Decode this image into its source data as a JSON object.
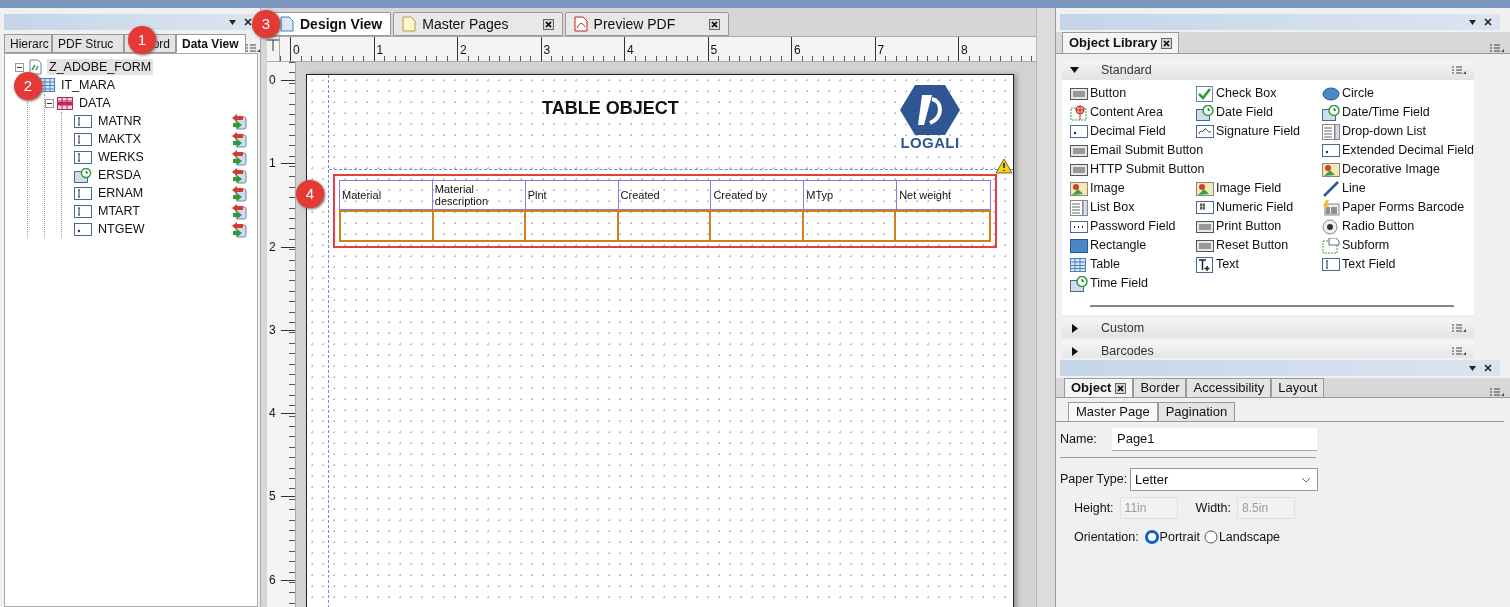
{
  "callouts": [
    {
      "number": "1"
    },
    {
      "number": "2"
    },
    {
      "number": "3"
    },
    {
      "number": "4"
    }
  ],
  "left_panel": {
    "tabs": [
      {
        "label": "Hierarc",
        "selected": false
      },
      {
        "label": "PDF Struc",
        "selected": false
      },
      {
        "label": "ord",
        "selected": false
      },
      {
        "label": "Data View",
        "selected": true
      }
    ],
    "tree": [
      {
        "label": "Z_ADOBE_FORM",
        "kind": "form",
        "expanded": true,
        "selected": true,
        "children": [
          {
            "label": "IT_MARA",
            "kind": "table",
            "selected": false,
            "children": [
              {
                "label": "DATA",
                "kind": "data",
                "expanded": true,
                "selected": false,
                "children": [
                  {
                    "label": "MATNR",
                    "kind": "text",
                    "selected": false,
                    "bound": true
                  },
                  {
                    "label": "MAKTX",
                    "kind": "text",
                    "selected": false,
                    "bound": true
                  },
                  {
                    "label": "WERKS",
                    "kind": "text",
                    "selected": false,
                    "bound": true
                  },
                  {
                    "label": "ERSDA",
                    "kind": "date",
                    "selected": false,
                    "bound": true
                  },
                  {
                    "label": "ERNAM",
                    "kind": "text",
                    "selected": false,
                    "bound": true
                  },
                  {
                    "label": "MTART",
                    "kind": "text",
                    "selected": false,
                    "bound": true
                  },
                  {
                    "label": "NTGEW",
                    "kind": "decimal",
                    "selected": false,
                    "bound": true
                  }
                ]
              }
            ]
          }
        ]
      }
    ]
  },
  "document_tabs": [
    {
      "label": "Design View",
      "kind": "design",
      "selected": true,
      "closable": false
    },
    {
      "label": "Master Pages",
      "kind": "page",
      "selected": false,
      "closable": true
    },
    {
      "label": "Preview PDF",
      "kind": "pdf",
      "selected": false,
      "closable": true
    }
  ],
  "rulers": {
    "horizontal": [
      "0",
      "1",
      "2",
      "3",
      "4",
      "5",
      "6",
      "7",
      "8"
    ],
    "vertical": [
      "0",
      "1",
      "2",
      "3",
      "4",
      "5",
      "6"
    ]
  },
  "page": {
    "title": "TABLE OBJECT",
    "logo_text": "LOGALI",
    "warning": true,
    "table": {
      "columns": [
        "Material",
        "Material description",
        "Plnt",
        "Created",
        "Created by",
        "MTyp",
        "Net weight"
      ]
    }
  },
  "object_library": {
    "tab": "Object Library",
    "sections": [
      {
        "label": "Standard",
        "expanded": true,
        "rows": [
          {
            "col_1": {
              "label": "Button",
              "kind": "button"
            },
            "col_2": {
              "label": "Check Box",
              "kind": "check"
            },
            "col_3": {
              "label": "Circle",
              "kind": "circle"
            }
          },
          {
            "col_1": {
              "label": "Content Area",
              "kind": "content"
            },
            "col_2": {
              "label": "Date Field",
              "kind": "clock"
            },
            "col_3": {
              "label": "Date/Time Field",
              "kind": "clock"
            }
          },
          {
            "col_1": {
              "label": "Decimal Field",
              "kind": "field"
            },
            "col_2": {
              "label": "Signature Field",
              "kind": "signature"
            },
            "col_3": {
              "label": "Drop-down List",
              "kind": "list"
            }
          },
          {
            "col_1": {
              "label": "Email Submit Button",
              "kind": "button"
            },
            "col_3": {
              "label": "Extended Decimal Field",
              "kind": "field"
            }
          },
          {
            "col_1": {
              "label": "HTTP Submit Button",
              "kind": "button"
            },
            "col_3": {
              "label": "Decorative Image",
              "kind": "image"
            }
          },
          {
            "col_1": {
              "label": "Image",
              "kind": "image"
            },
            "col_2": {
              "label": "Image Field",
              "kind": "image"
            },
            "col_3": {
              "label": "Line",
              "kind": "line"
            }
          },
          {
            "col_1": {
              "label": "List Box",
              "kind": "list"
            },
            "col_2": {
              "label": "Numeric Field",
              "kind": "numeric"
            },
            "col_3": {
              "label": "Paper Forms Barcode",
              "kind": "barcode"
            }
          },
          {
            "col_1": {
              "label": "Password Field",
              "kind": "password"
            },
            "col_2": {
              "label": "Print Button",
              "kind": "button"
            },
            "col_3": {
              "label": "Radio Button",
              "kind": "radio"
            }
          },
          {
            "col_1": {
              "label": "Rectangle",
              "kind": "rectangle"
            },
            "col_2": {
              "label": "Reset Button",
              "kind": "button"
            },
            "col_3": {
              "label": "Subform",
              "kind": "subform"
            }
          },
          {
            "col_1": {
              "label": "Table",
              "kind": "table"
            },
            "col_2": {
              "label": "Text",
              "kind": "text"
            },
            "col_3": {
              "label": "Text Field",
              "kind": "textfield"
            }
          },
          {
            "col_1": {
              "label": "Time Field",
              "kind": "clock"
            }
          }
        ]
      },
      {
        "label": "Custom",
        "expanded": false
      },
      {
        "label": "Barcodes",
        "expanded": false
      }
    ]
  },
  "object_panel": {
    "tabs": [
      {
        "label": "Object",
        "selected": true,
        "closable": true
      },
      {
        "label": "Border",
        "selected": false,
        "closable": false
      },
      {
        "label": "Accessibility",
        "selected": false,
        "closable": false
      },
      {
        "label": "Layout",
        "selected": false,
        "closable": false
      }
    ],
    "subtabs": [
      {
        "label": "Master Page",
        "selected": true
      },
      {
        "label": "Pagination",
        "selected": false
      }
    ],
    "name": {
      "label": "Name:",
      "value": "Page1"
    },
    "paper_type": {
      "label": "Paper Type:",
      "value": "Letter"
    },
    "height": {
      "label": "Height:",
      "value": "11in",
      "disabled": true
    },
    "width": {
      "label": "Width:",
      "value": "8.5in",
      "disabled": true
    },
    "orientation": {
      "label": "Orientation:",
      "options": [
        {
          "label": "Portrait",
          "selected": true
        },
        {
          "label": "Landscape",
          "selected": false
        }
      ]
    }
  }
}
